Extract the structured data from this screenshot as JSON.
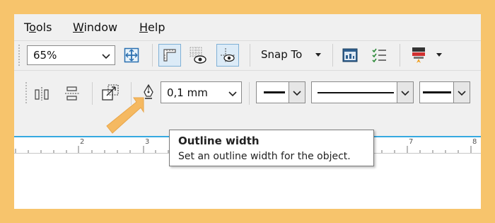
{
  "menubar": {
    "items": [
      {
        "label": "Tools",
        "underline": "o"
      },
      {
        "label": "Window",
        "underline": "W"
      },
      {
        "label": "Help",
        "underline": "H"
      }
    ]
  },
  "toolbar1": {
    "zoom_value": "65%",
    "snap_to_label": "Snap To"
  },
  "toolbar2": {
    "outline_width_value": "0,1 mm"
  },
  "ruler": {
    "labels": [
      "2",
      "3",
      "7",
      "8"
    ]
  },
  "tooltip": {
    "title": "Outline width",
    "text": "Set an outline width for the object."
  },
  "colors": {
    "background_frame": "#f7c46c",
    "toolbar_bg": "#f0f0f0",
    "accent_line": "#35a9e0",
    "arrow": "#f5b961"
  }
}
